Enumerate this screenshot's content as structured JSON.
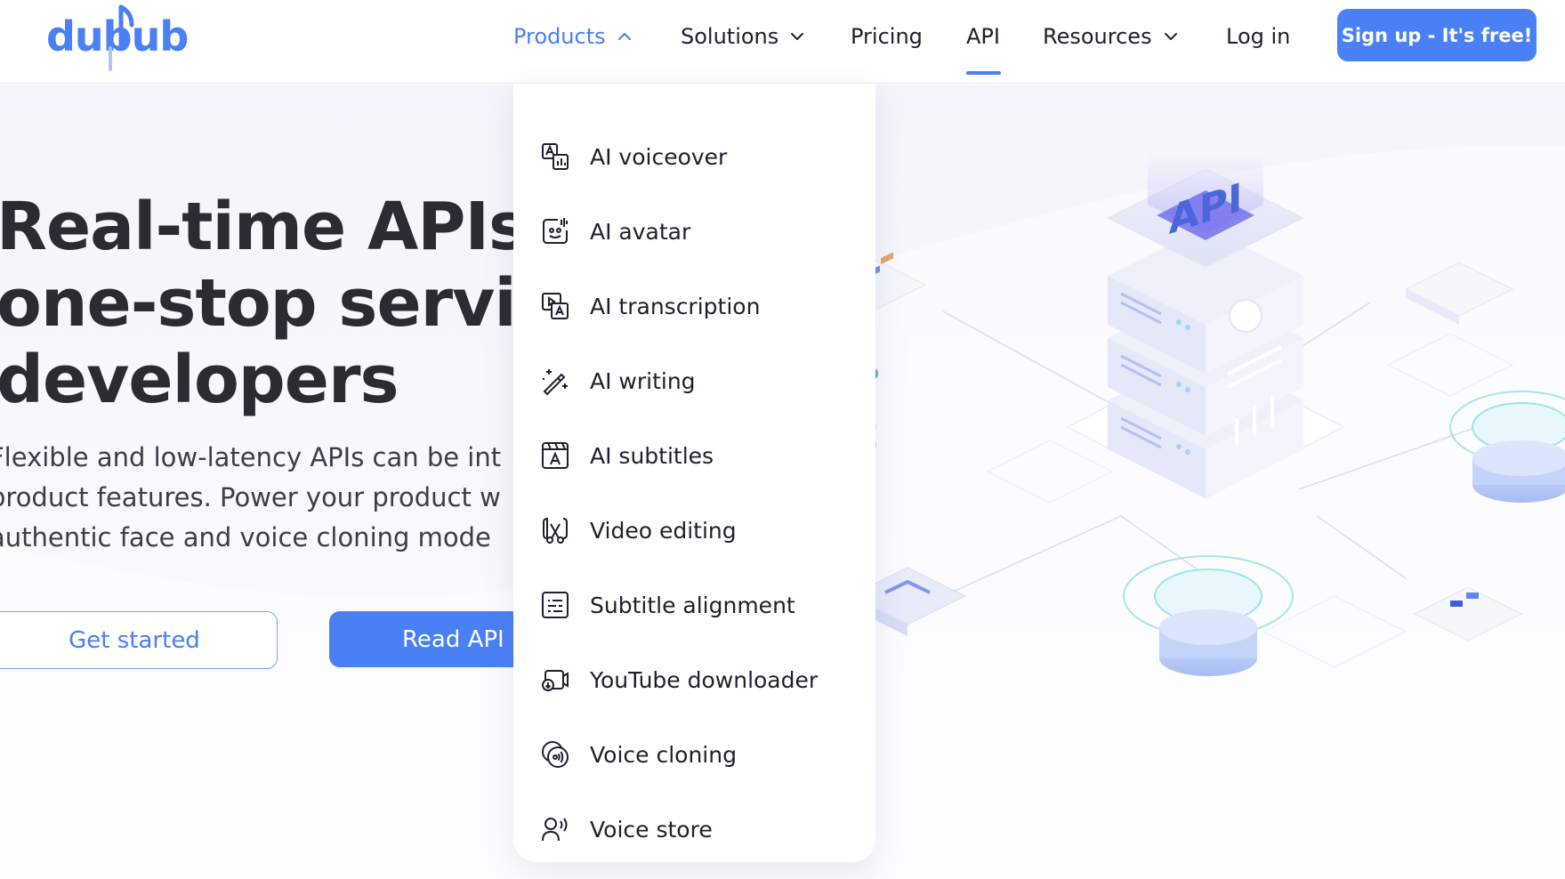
{
  "brand": {
    "logo_text": "dubub"
  },
  "nav": {
    "items": [
      {
        "label": "Products",
        "has_chevron": true,
        "chevron": "up",
        "active": true
      },
      {
        "label": "Solutions",
        "has_chevron": true,
        "chevron": "down"
      },
      {
        "label": "Pricing"
      },
      {
        "label": "API",
        "underlined": true
      },
      {
        "label": "Resources",
        "has_chevron": true,
        "chevron": "down"
      },
      {
        "label": "Log in"
      }
    ],
    "signup_label": "Sign up - It's free!"
  },
  "dropdown": {
    "items": [
      {
        "label": "AI voiceover",
        "icon": "translate-icon"
      },
      {
        "label": "AI avatar",
        "icon": "avatar-icon"
      },
      {
        "label": "AI transcription",
        "icon": "transcription-icon"
      },
      {
        "label": "AI writing",
        "icon": "magic-wand-icon"
      },
      {
        "label": "AI subtitles",
        "icon": "subtitles-icon"
      },
      {
        "label": "Video editing",
        "icon": "scissors-icon"
      },
      {
        "label": "Subtitle alignment",
        "icon": "alignment-icon"
      },
      {
        "label": "YouTube downloader",
        "icon": "video-download-icon"
      },
      {
        "label": "Voice cloning",
        "icon": "voice-cloning-icon"
      },
      {
        "label": "Voice store",
        "icon": "voice-store-icon"
      }
    ]
  },
  "hero": {
    "title_lines": [
      "Real-time APIs w",
      "one-stop servic",
      "developers"
    ],
    "desc_lines": [
      "Flexible and low-latency APIs can be int",
      "product features. Power your product w",
      "authentic face and voice cloning mode"
    ],
    "get_started_label": "Get started",
    "read_api_label": "Read API"
  },
  "illustration": {
    "server_label": "API"
  },
  "colors": {
    "accent": "#4a80f6",
    "text": "#1f1f2e"
  }
}
